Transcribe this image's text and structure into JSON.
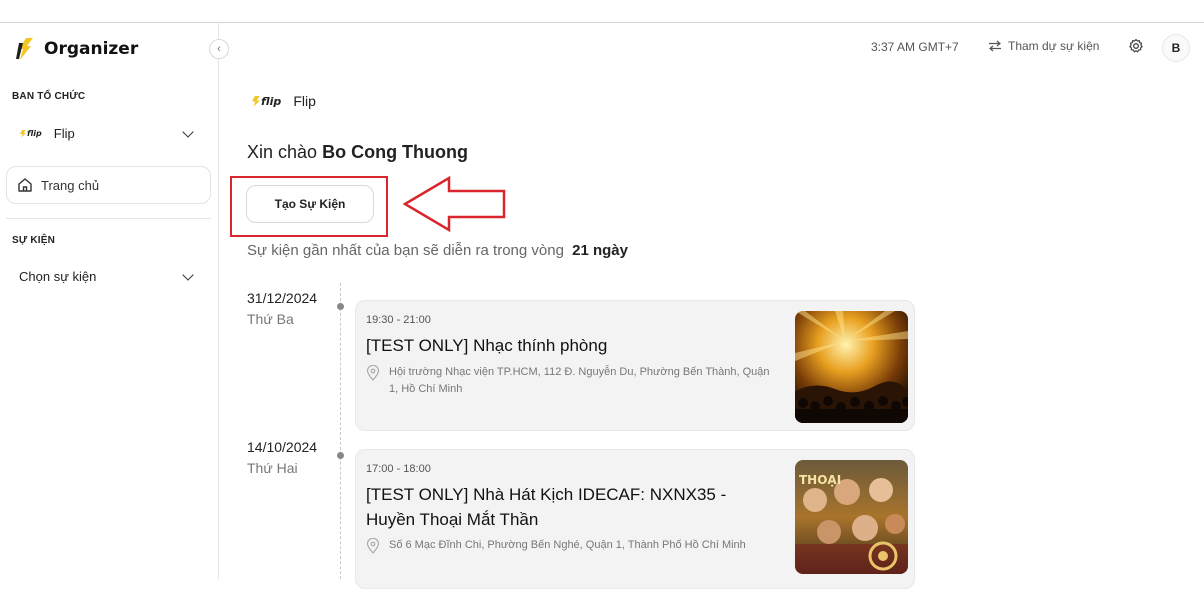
{
  "sidebar": {
    "app_title": "Organizer",
    "org_section_label": "BAN TỔ CHỨC",
    "org_name": "Flip",
    "org_logo_text": "flip",
    "home_label": "Trang chủ",
    "event_section_label": "SỰ KIỆN",
    "event_select_label": "Chọn sự kiện"
  },
  "header": {
    "time": "3:37 AM GMT+7",
    "join_label": "Tham dự sự kiện",
    "avatar_initial": "B"
  },
  "main": {
    "org_logo_text": "flip",
    "org_name": "Flip",
    "greeting_prefix": "Xin chào",
    "user_name": "Bo Cong Thuong",
    "create_button": "Tạo Sự Kiện",
    "upcoming_text": "Sự kiện gần nhất của bạn sẽ diễn ra trong vòng",
    "upcoming_days": "21 ngày",
    "events": [
      {
        "date": "31/12/2024",
        "weekday": "Thứ Ba",
        "time": "19:30 - 21:00",
        "title": "[TEST ONLY] Nhạc thính phòng",
        "location": "Hội trường Nhạc viện TP.HCM, 112 Đ. Nguyễn Du, Phường Bến Thành, Quận 1, Hồ Chí Minh"
      },
      {
        "date": "14/10/2024",
        "weekday": "Thứ Hai",
        "time": "17:00 - 18:00",
        "title": "[TEST ONLY] Nhà Hát Kịch IDECAF: NXNX35 - Huyền Thoại Mắt Thần",
        "location": "Số 6 Mạc Đĩnh Chi, Phường Bến Nghé, Quận 1, Thành Phố Hồ Chí Minh",
        "poster_text": "THOẠI"
      }
    ]
  },
  "colors": {
    "highlight_red": "#d9262c",
    "brand_yellow": "#f3c623"
  }
}
